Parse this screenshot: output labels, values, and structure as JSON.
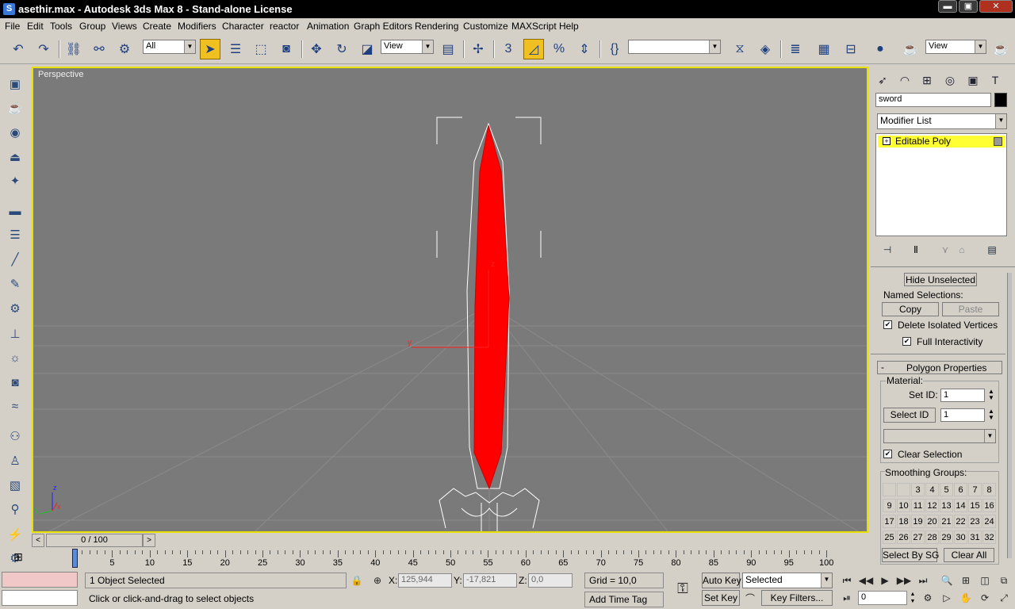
{
  "window": {
    "title": "asethir.max - Autodesk 3ds Max 8 - Stand-alone License",
    "icon": "S"
  },
  "menu": [
    "File",
    "Edit",
    "Tools",
    "Group",
    "Views",
    "Create",
    "Modifiers",
    "Character",
    "reactor",
    "Animation",
    "Graph Editors",
    "Rendering",
    "Customize",
    "MAXScript",
    "Help"
  ],
  "toolbar": {
    "selection_filter": "All",
    "ref_coord": "View",
    "snap_percent_label": "3",
    "named_selection": "",
    "render_view": "View"
  },
  "viewport": {
    "label": "Perspective",
    "axis_y": "y",
    "axis_z": "z",
    "axis_x": "x"
  },
  "command_panel": {
    "object_name": "sword",
    "object_color": "#000000",
    "modifier_list": "Modifier List",
    "stack_item": "Editable Poly",
    "hide_unselected": "Hide Unselected",
    "named_selections": "Named Selections:",
    "copy": "Copy",
    "paste": "Paste",
    "delete_isolated": "Delete Isolated Vertices",
    "full_interactivity": "Full Interactivity",
    "rollout_title": "Polygon Properties",
    "material": "Material:",
    "set_id_label": "Set ID:",
    "set_id_value": "1",
    "select_id": "Select ID",
    "select_id_value": "1",
    "clear_selection": "Clear Selection",
    "smoothing_groups": "Smoothing Groups:",
    "sg_numbers": [
      "",
      "",
      "3",
      "4",
      "5",
      "6",
      "7",
      "8",
      "9",
      "10",
      "11",
      "12",
      "13",
      "14",
      "15",
      "16",
      "17",
      "18",
      "19",
      "20",
      "21",
      "22",
      "23",
      "24",
      "25",
      "26",
      "27",
      "28",
      "29",
      "30",
      "31",
      "32"
    ],
    "select_by_sg": "Select By SG",
    "clear_all": "Clear All"
  },
  "timeline": {
    "frame": "0 / 100",
    "ticks": [
      "0",
      "5",
      "10",
      "15",
      "20",
      "25",
      "30",
      "35",
      "40",
      "45",
      "50",
      "55",
      "60",
      "65",
      "70",
      "75",
      "80",
      "85",
      "90",
      "95",
      "100"
    ]
  },
  "status": {
    "selection": "1 Object Selected",
    "prompt": "Click or click-and-drag to select objects",
    "x_label": "X:",
    "x_value": "125,944",
    "y_label": "Y:",
    "y_value": "-17,821",
    "z_label": "Z:",
    "z_value": "0,0",
    "grid": "Grid = 10,0",
    "add_time_tag": "Add Time Tag",
    "auto_key": "Auto Key",
    "set_key": "Set Key",
    "key_mode": "Selected",
    "key_filters": "Key Filters...",
    "current_frame": "0"
  },
  "colors": {
    "viewport_border": "#e8e000",
    "selection_red": "#ff0000",
    "stack_highlight": "#ffff33",
    "active_tool": "#f0c020"
  }
}
